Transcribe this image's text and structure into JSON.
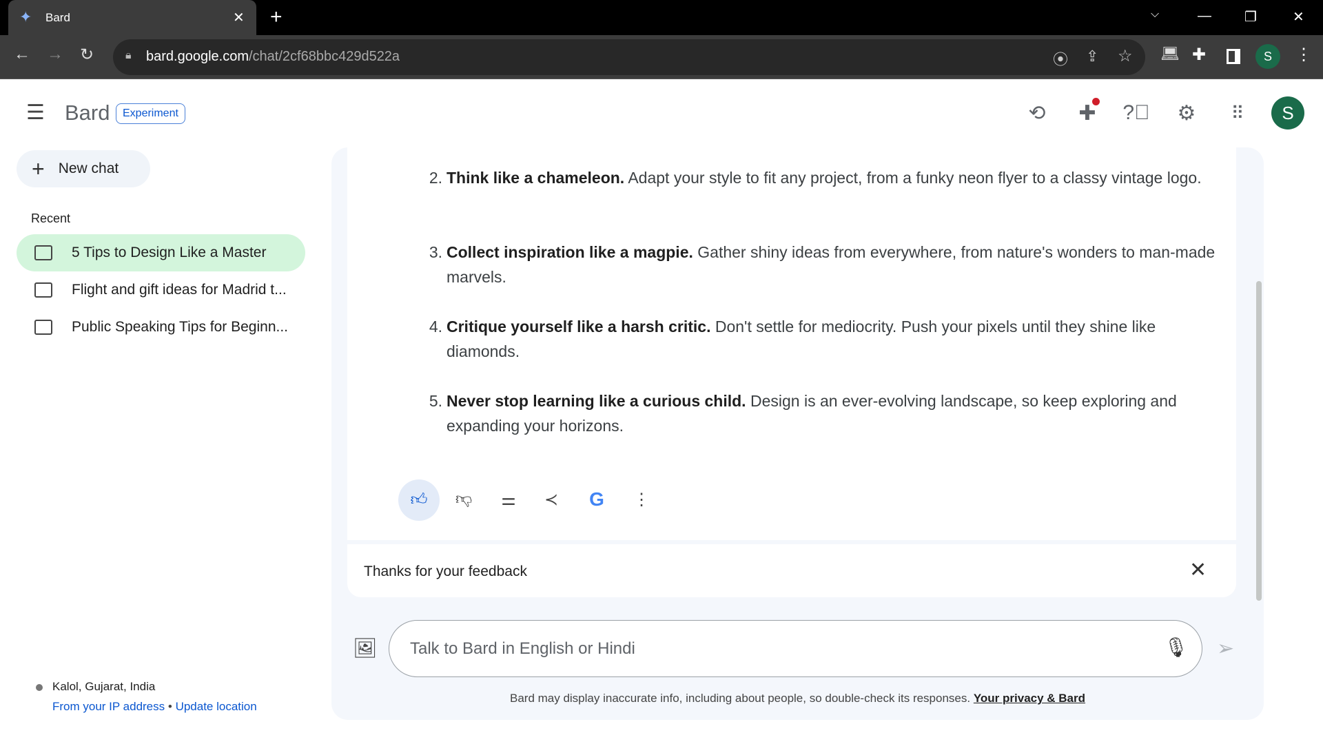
{
  "browser": {
    "tab_title": "Bard",
    "url_host": "bard.google.com",
    "url_path": "/chat/2cf68bbc429d522a",
    "profile_initial": "S"
  },
  "header": {
    "app_name": "Bard",
    "badge": "Experiment",
    "avatar_initial": "S"
  },
  "sidebar": {
    "new_chat": "New chat",
    "recent_label": "Recent",
    "items": [
      {
        "label": "5 Tips to Design Like a Master",
        "active": true
      },
      {
        "label": "Flight and gift ideas for Madrid t...",
        "active": false
      },
      {
        "label": "Public Speaking Tips for Beginn...",
        "active": false
      }
    ],
    "location": {
      "place": "Kalol, Gujarat, India",
      "source": "From your IP address",
      "separator": "•",
      "update": "Update location"
    }
  },
  "response": {
    "items": [
      {
        "num": "2.",
        "bold": "Think like a chameleon.",
        "text": " Adapt your style to fit any project, from a funky neon flyer to a classy vintage logo."
      },
      {
        "num": "3.",
        "bold": "Collect inspiration like a magpie.",
        "text": " Gather shiny ideas from everywhere, from nature's wonders to man-made marvels."
      },
      {
        "num": "4.",
        "bold": "Critique yourself like a harsh critic.",
        "text": " Don't settle for mediocrity. Push your pixels until they shine like diamonds."
      },
      {
        "num": "5.",
        "bold": "Never stop learning like a curious child.",
        "text": " Design is an ever-evolving landscape, so keep exploring and expanding your horizons."
      }
    ],
    "thumbs_up_selected": true
  },
  "feedback": {
    "text": "Thanks for your feedback"
  },
  "input": {
    "placeholder": "Talk to Bard in English or Hindi",
    "value": ""
  },
  "footer": {
    "disclaimer": "Bard may display inaccurate info, including about people, so double-check its responses. ",
    "privacy_link": "Your privacy & Bard"
  },
  "colors": {
    "active_item": "#d3f5dc",
    "accent_blue": "#0b57d0",
    "avatar": "#1a6b4a"
  }
}
